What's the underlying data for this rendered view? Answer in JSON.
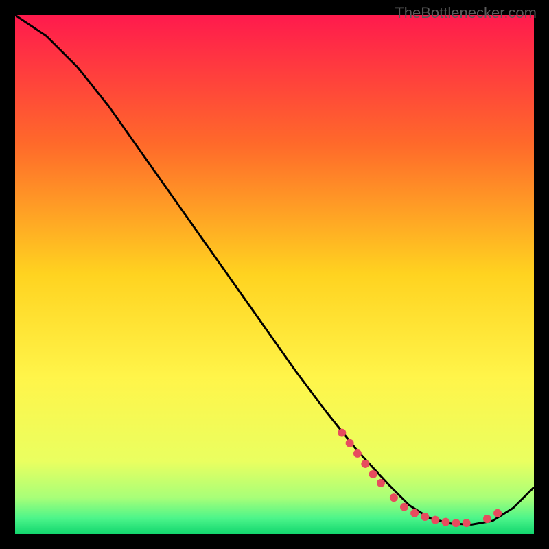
{
  "watermark": "TheBottlenecker.com",
  "chart_data": {
    "type": "line",
    "title": "",
    "xlabel": "",
    "ylabel": "",
    "xlim": [
      0,
      100
    ],
    "ylim": [
      0,
      100
    ],
    "background_gradient": {
      "stops": [
        {
          "offset": 0,
          "color": "#ff1a4d"
        },
        {
          "offset": 25,
          "color": "#ff6a2a"
        },
        {
          "offset": 50,
          "color": "#ffd320"
        },
        {
          "offset": 70,
          "color": "#fff54a"
        },
        {
          "offset": 86,
          "color": "#eaff60"
        },
        {
          "offset": 93,
          "color": "#a8ff78"
        },
        {
          "offset": 97,
          "color": "#4cf58a"
        },
        {
          "offset": 100,
          "color": "#12d66e"
        }
      ]
    },
    "series": [
      {
        "name": "curve",
        "color": "#000000",
        "x": [
          0,
          6,
          12,
          18,
          24,
          30,
          36,
          42,
          48,
          54,
          60,
          66,
          72,
          76,
          80,
          84,
          88,
          92,
          96,
          100
        ],
        "y": [
          100,
          96,
          90,
          82.5,
          74,
          65.5,
          57,
          48.5,
          40,
          31.5,
          23.5,
          16,
          9.5,
          5.5,
          3,
          2,
          1.8,
          2.5,
          5,
          9
        ]
      }
    ],
    "markers": [
      {
        "x": 63,
        "y": 19.5
      },
      {
        "x": 64.5,
        "y": 17.5
      },
      {
        "x": 66,
        "y": 15.5
      },
      {
        "x": 67.5,
        "y": 13.5
      },
      {
        "x": 69,
        "y": 11.5
      },
      {
        "x": 70.5,
        "y": 9.8
      },
      {
        "x": 73,
        "y": 7
      },
      {
        "x": 75,
        "y": 5.2
      },
      {
        "x": 77,
        "y": 4
      },
      {
        "x": 79,
        "y": 3.3
      },
      {
        "x": 81,
        "y": 2.7
      },
      {
        "x": 83,
        "y": 2.3
      },
      {
        "x": 85,
        "y": 2.1
      },
      {
        "x": 87,
        "y": 2.1
      },
      {
        "x": 91,
        "y": 2.9
      },
      {
        "x": 93,
        "y": 4
      }
    ],
    "marker_style": {
      "fill": "#e74c5e",
      "radius_px": 6
    }
  }
}
